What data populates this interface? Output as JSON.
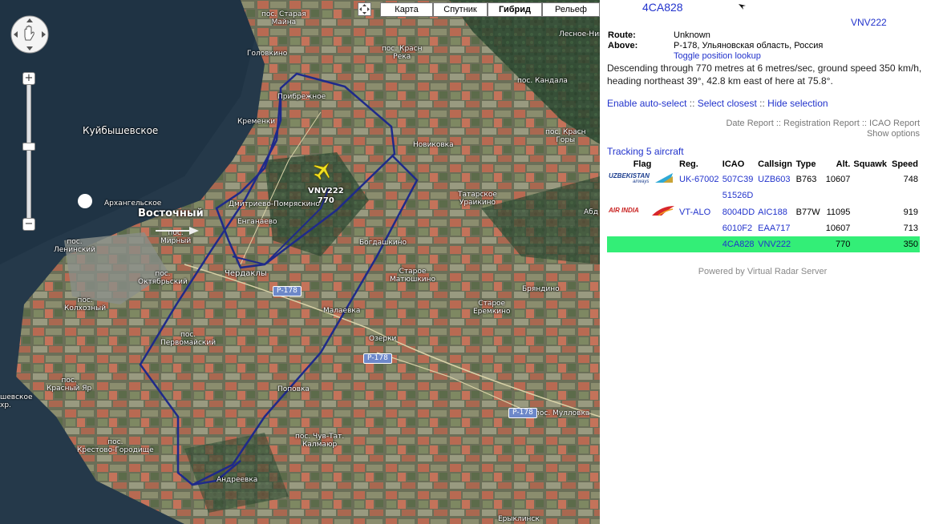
{
  "map": {
    "map_types": [
      {
        "label": "Карта",
        "active": false
      },
      {
        "label": "Спутник",
        "active": false
      },
      {
        "label": "Гибрид",
        "active": true
      },
      {
        "label": "Рельеф",
        "active": false
      }
    ],
    "labels": {
      "staraya_maina": "пос. Старая\nМайна",
      "golovkino": "Головкино",
      "krasnaya_reka": "пос. Красн\nРека",
      "lesnoe_nikitino": "Лесное-Ник",
      "pribrezhnoe": "Прибрежное",
      "kremenki": "Кременки",
      "kuybyshevskoe": "Куйбышевское",
      "novikovka": "Новиковка",
      "kandala": "пос. Кандала",
      "krasnaya_g": "пос. Красн\nГоры",
      "kandala2": "Кандала",
      "arkhangelskoe": "Архангельское",
      "vostochny": "Восточный",
      "dmitrovo": "Дмитриево-Помряскино",
      "yenganaevo": "Енганаево",
      "tatarskoe": "Татарское\nУраикино",
      "abd": "Абд",
      "leninsky": "пос.\nЛенинский",
      "mirny": "пос.\nМирный",
      "oktyabrsky": "пос.\nОктябрьский",
      "cherdakly": "Чердаклы",
      "bogdashkino": "Богдашкино",
      "staroe_mat": "Старое\nМатюшкино",
      "kolkhozny": "пос.\nКолхозный",
      "malaevka": "Малаевка",
      "bryandino": "Бряндино",
      "staroe_eremkino": "Старое\nЕремкино",
      "pervomaisky": "пос.\nПервомайский",
      "ozerki": "Озерки",
      "krasny_yar": "пос.\nКрасный Яр",
      "shevskoe": "шевское\nхр.",
      "popovka": "Поповка",
      "mullovka": "пос. Мулловка",
      "chuv_tat": "пос. Чув-Тат.\nКалмаюр",
      "krestovo": "пос.\nКрестово-Городище",
      "andreevka": "Андреевка",
      "erykly": "Ерыклинск"
    },
    "roads": [
      "Р-178",
      "Р-178",
      "Р-178"
    ],
    "plane": {
      "callsign": "VNV222",
      "altitude": "770"
    }
  },
  "panel": {
    "registration": "4CA828",
    "callsign": "VNV222",
    "route_label": "Route:",
    "route_value": "Unknown",
    "above_label": "Above:",
    "above_value": "Р-178, Ульяновская область, Россия",
    "toggle_lookup": "Toggle position lookup",
    "description": "Descending through 770 metres at 6 metres/sec, ground speed 350 km/h, heading northeast 39°, 42.8 km east of here at 75.8°.",
    "actions": {
      "auto_select": "Enable auto-select",
      "select_closest": "Select closest",
      "hide_selection": "Hide selection",
      "sep": "::"
    },
    "reports": {
      "date": "Date Report",
      "registration": "Registration Report",
      "icao": "ICAO Report",
      "sep": "::",
      "show_options": "Show options"
    },
    "tracking": "Tracking 5 aircraft",
    "table": {
      "headers": [
        "Flag",
        "Reg.",
        "ICAO",
        "Callsign",
        "Type",
        "Alt.",
        "Squawk",
        "Speed"
      ],
      "rows": [
        {
          "flag": "uzbekistan",
          "reg": "UK-67002",
          "icao": "507C39",
          "callsign": "UZB603",
          "type": "B763",
          "alt": "10607",
          "squawk": "",
          "speed": "748",
          "selected": false
        },
        {
          "flag": "",
          "reg": "",
          "icao": "51526D",
          "callsign": "",
          "type": "",
          "alt": "",
          "squawk": "",
          "speed": "",
          "selected": false
        },
        {
          "flag": "airindia",
          "reg": "VT-ALO",
          "icao": "8004DD",
          "callsign": "AIC188",
          "type": "B77W",
          "alt": "11095",
          "squawk": "",
          "speed": "919",
          "selected": false
        },
        {
          "flag": "",
          "reg": "",
          "icao": "6010F2",
          "callsign": "EAA717",
          "type": "",
          "alt": "10607",
          "squawk": "",
          "speed": "713",
          "selected": false
        },
        {
          "flag": "",
          "reg": "",
          "icao": "4CA828",
          "callsign": "VNV222",
          "type": "",
          "alt": "770",
          "squawk": "",
          "speed": "350",
          "selected": true
        }
      ],
      "flag_text": {
        "uzbekistan": "UZBEKISTAN",
        "uzbekistan_sub": "airways",
        "airindia": "AIR INDIA"
      }
    },
    "powered_by": "Powered by Virtual Radar Server"
  }
}
